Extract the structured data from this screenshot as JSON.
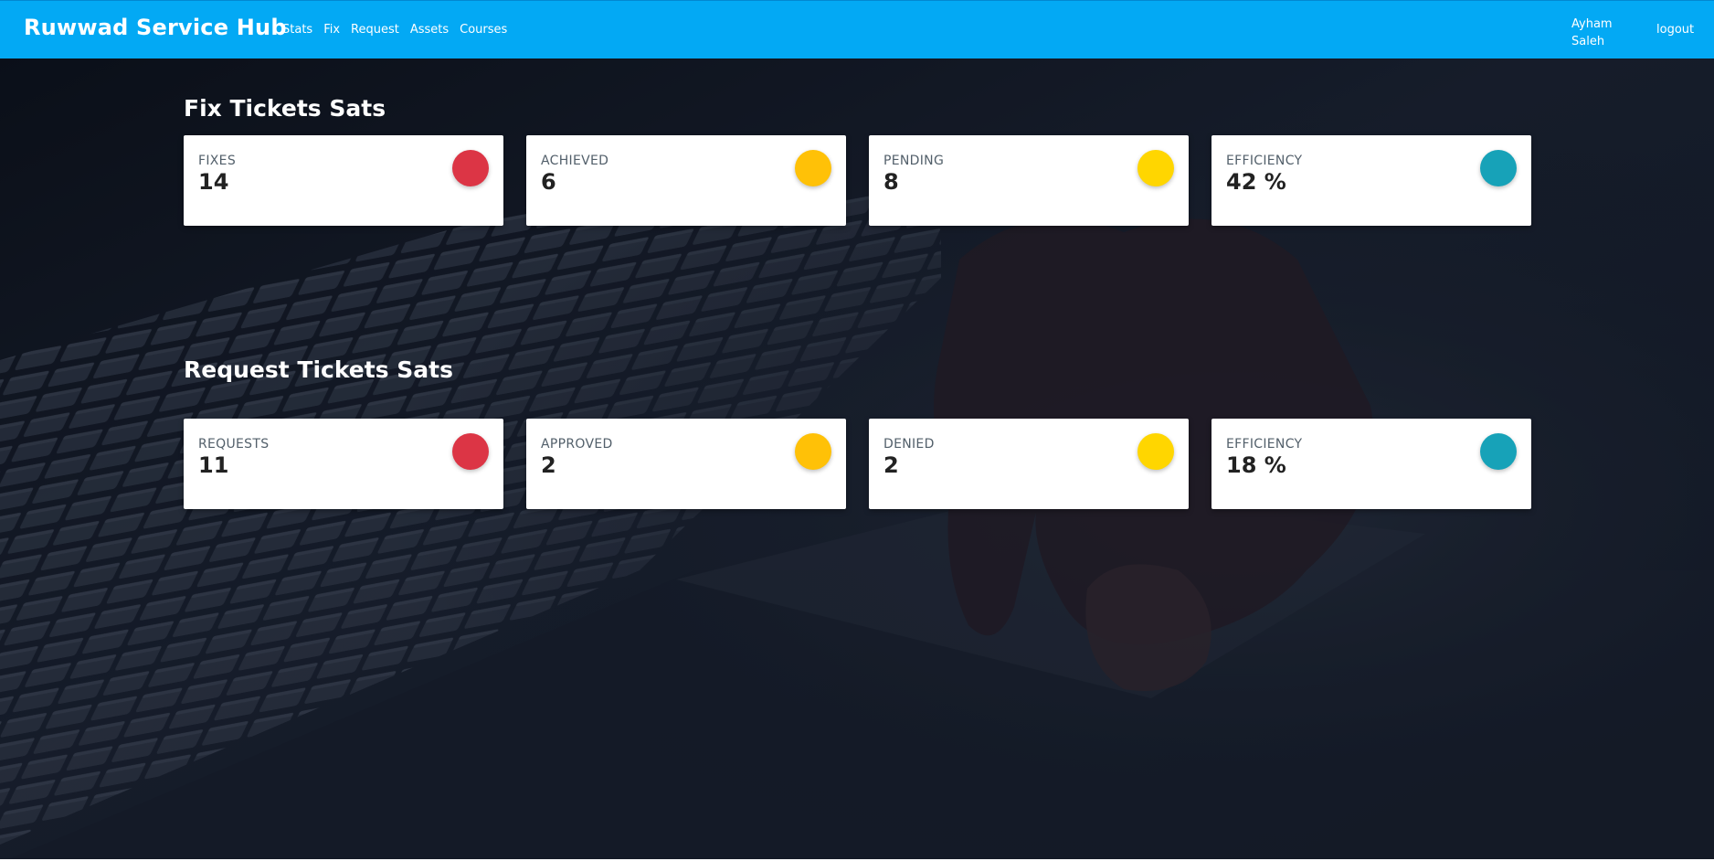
{
  "navbar": {
    "brand": "Ruwwad Service Hub",
    "links": [
      "Stats",
      "Fix",
      "Request",
      "Assets",
      "Courses"
    ],
    "user_name": "Ayham Saleh",
    "logout_label": "logout",
    "color": "#03a9f4"
  },
  "fix_section": {
    "title": "Fix Tickets Sats",
    "cards": [
      {
        "label": "FIXES",
        "value": "14",
        "icon": "circle-icon",
        "color": "#dc3545"
      },
      {
        "label": "ACHIEVED",
        "value": "6",
        "icon": "circle-icon",
        "color": "#ffc107"
      },
      {
        "label": "PENDING",
        "value": "8",
        "icon": "circle-icon",
        "color": "#ffd600"
      },
      {
        "label": "EFFICIENCY",
        "value": "42 %",
        "icon": "circle-icon",
        "color": "#17a2b8"
      }
    ]
  },
  "request_section": {
    "title": "Request Tickets Sats",
    "cards": [
      {
        "label": "REQUESTS",
        "value": "11",
        "icon": "circle-icon",
        "color": "#dc3545"
      },
      {
        "label": "APPROVED",
        "value": "2",
        "icon": "circle-icon",
        "color": "#ffc107"
      },
      {
        "label": "DENIED",
        "value": "2",
        "icon": "circle-icon",
        "color": "#ffd600"
      },
      {
        "label": "EFFICIENCY",
        "value": "18 %",
        "icon": "circle-icon",
        "color": "#17a2b8"
      }
    ]
  }
}
